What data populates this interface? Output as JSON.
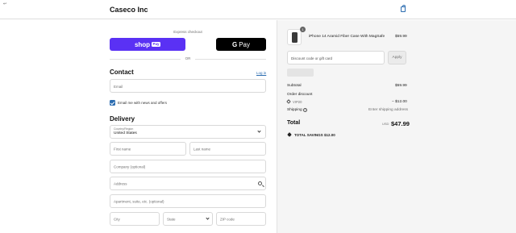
{
  "header": {
    "corner_mark": "↩",
    "store_name": "Caseco Inc"
  },
  "express": {
    "label": "Express checkout",
    "shop_pay_text": "shop",
    "shop_pay_chip": "Pay",
    "gpay_g": "G",
    "gpay_text": "Pay",
    "or": "OR"
  },
  "contact": {
    "title": "Contact",
    "login": "Log in",
    "email_placeholder": "Email",
    "newsletter_label": "Email me with news and offers",
    "newsletter_checked": true
  },
  "delivery": {
    "title": "Delivery",
    "country_label": "Country/Region",
    "country_value": "United States",
    "first_name": "First name",
    "last_name": "Last name",
    "company": "Company (optional)",
    "address": "Address",
    "apartment": "Apartment, suite, etc. (optional)",
    "city": "City",
    "state": "State",
    "zip": "ZIP code"
  },
  "summary": {
    "product_name": "iPhone 14 Aramid Fiber Case With MagSafe",
    "product_price": "$59.99",
    "quantity": "1",
    "discount_placeholder": "Discount code or gift card",
    "apply_label": "Apply",
    "subtotal_label": "Subtotal",
    "subtotal_value": "$59.99",
    "order_discount_label": "Order discount",
    "discount_code": "VIP20",
    "discount_value": "− $12.00",
    "shipping_label": "Shipping",
    "shipping_value": "Enter shipping address",
    "total_label": "Total",
    "currency": "USD",
    "total_value": "$47.99",
    "savings_label": "TOTAL SAVINGS",
    "savings_value": "$12.00"
  },
  "colors": {
    "shop_pay": "#5a31f4",
    "accent": "#2b6cb0"
  }
}
